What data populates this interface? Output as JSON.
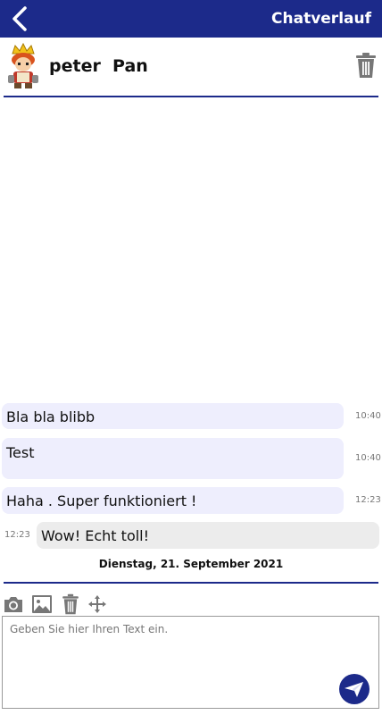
{
  "header": {
    "title": "Chatverlauf"
  },
  "contact": {
    "name": "peter  Pan"
  },
  "messages": [
    {
      "text": "Bla bla blibb",
      "time": "10:40",
      "direction": "outgoing"
    },
    {
      "text": "Test",
      "time": "10:40",
      "direction": "outgoing"
    },
    {
      "text": "Haha . Super funktioniert !",
      "time": "12:23",
      "direction": "outgoing"
    },
    {
      "text": "Wow! Echt toll!",
      "time": "12:23",
      "direction": "incoming"
    }
  ],
  "date_separator": "Dienstag, 21. September 2021",
  "composer": {
    "placeholder": "Geben Sie hier Ihren Text ein."
  },
  "toolbar_icons": [
    "camera-icon",
    "image-icon",
    "trash-icon",
    "move-icon"
  ],
  "colors": {
    "brand": "#1c2a8a",
    "outgoing_bubble": "#eeeefd",
    "incoming_bubble": "#ececec"
  }
}
